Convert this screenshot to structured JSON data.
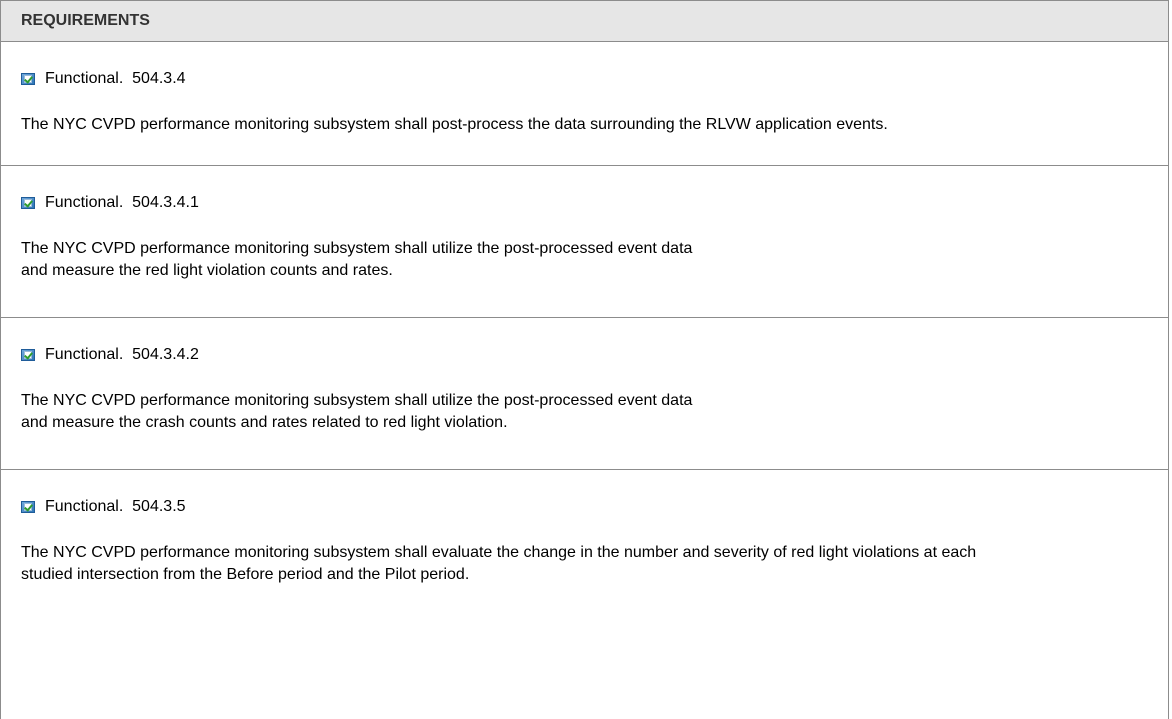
{
  "header": {
    "title": "REQUIREMENTS"
  },
  "requirements": [
    {
      "type": "Functional.",
      "id": "504.3.4",
      "icon": "checkbox-icon",
      "text": "The NYC CVPD performance monitoring subsystem shall post-process the data surrounding the RLVW application events."
    },
    {
      "type": "Functional.",
      "id": "504.3.4.1",
      "icon": "checkbox-icon",
      "text": "The NYC CVPD performance monitoring subsystem shall utilize the post-processed event data and measure the red light violation counts and rates."
    },
    {
      "type": "Functional.",
      "id": "504.3.4.2",
      "icon": "checkbox-icon",
      "text": "The NYC CVPD performance monitoring subsystem shall utilize the post-processed event data and measure the crash counts and rates related to red light violation."
    },
    {
      "type": "Functional.",
      "id": "504.3.5",
      "icon": "checkbox-icon",
      "text": "The NYC CVPD performance monitoring subsystem shall evaluate the change in the number and severity of red light violations at each studied intersection from the Before period and the Pilot period."
    }
  ]
}
